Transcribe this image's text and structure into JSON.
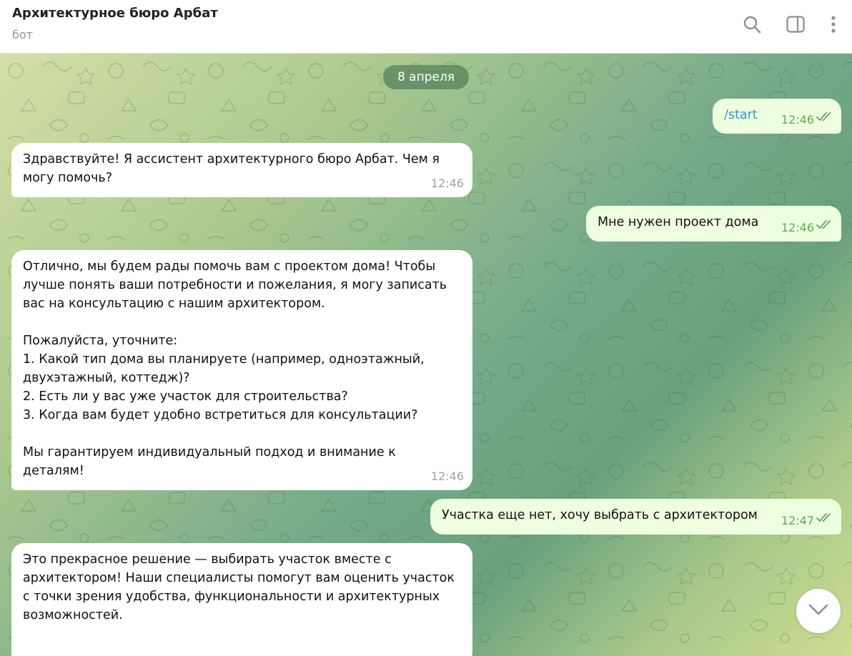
{
  "header": {
    "title": "Архитектурное бюро Арбат",
    "status": "бот",
    "icons": [
      "search-icon",
      "sidebar-toggle-icon",
      "more-vert-icon"
    ]
  },
  "chat": {
    "date": "8 апреля",
    "messages": [
      {
        "direction": "out",
        "text": "/start",
        "time": "12:46",
        "status": "read"
      },
      {
        "direction": "in",
        "text": "Здравствуйте! Я ассистент архитектурного бюро Арбат. Чем я\nмогу помочь?",
        "time": "12:46"
      },
      {
        "direction": "out",
        "text": "Мне нужен проект дома",
        "time": "12:46",
        "status": "read"
      },
      {
        "direction": "in",
        "text": "Отлично, мы будем рады помочь вам с проектом дома! Чтобы\nлучше понять ваши потребности и пожелания, я могу записать\nвас на консультацию с нашим архитектором.\n\nПожалуйста, уточните:\n1. Какой тип дома вы планируете (например, одноэтажный,\nдвухэтажный, коттедж)?\n2. Есть ли у вас уже участок для строительства?\n3. Когда вам будет удобно встретиться для консультации?\n\nМы гарантируем индивидуальный подход и внимание к\nдеталям!",
        "time": "12:46"
      },
      {
        "direction": "out",
        "text": "Участка еще нет, хочу выбрать с архитектором",
        "time": "12:47",
        "status": "read"
      },
      {
        "direction": "in",
        "text": "Это прекрасное решение — выбирать участок вместе с\nархитектором! Наши специалисты помогут вам оценить участок\nс точки зрения удобства, функциональности и архитектурных\nвозможностей.",
        "time": ""
      }
    ]
  },
  "colors": {
    "incoming_bubble": "#ffffff",
    "outgoing_bubble": "#eeffdf",
    "outgoing_time": "#5fa95a",
    "incoming_time": "#9aa4ad",
    "command_link": "#3a8fd6",
    "date_chip": "#56825a"
  },
  "scroll_button": {
    "icon": "chevron-down-icon"
  }
}
